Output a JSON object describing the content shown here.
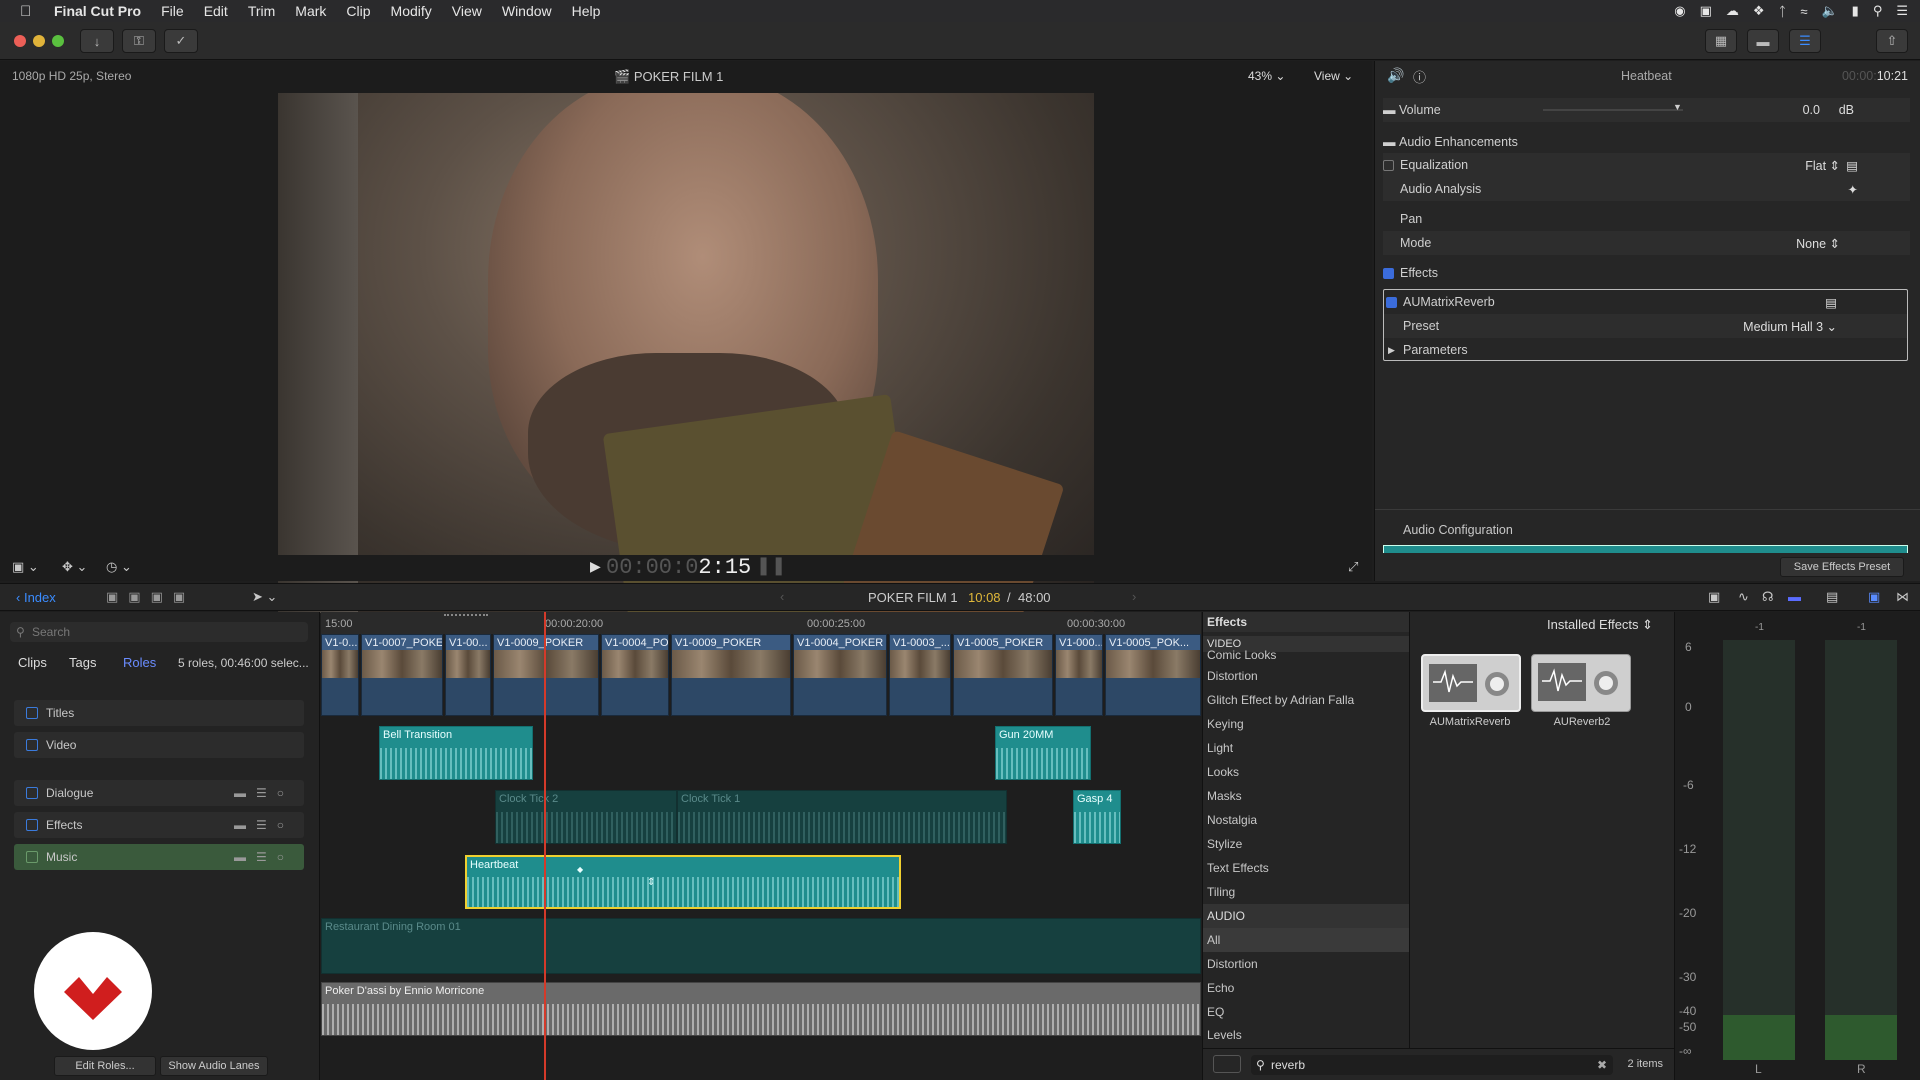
{
  "menubar": {
    "app_name": "Final Cut Pro",
    "items": [
      "File",
      "Edit",
      "Trim",
      "Mark",
      "Clip",
      "Modify",
      "View",
      "Window",
      "Help"
    ]
  },
  "viewer": {
    "format_info": "1080p HD 25p, Stereo",
    "project_title": "POKER FILM 1",
    "zoom": "43%",
    "view_label": "View",
    "timecode_dim": "00:00:0",
    "timecode_bright": "2:15"
  },
  "inspector": {
    "clip_name": "Heatbeat",
    "timecode_dim": "00:00:",
    "timecode_bright": "10:21",
    "volume_label": "Volume",
    "volume_value": "0.0",
    "volume_unit": "dB",
    "audio_enhancements": "Audio Enhancements",
    "equalization": "Equalization",
    "eq_value": "Flat",
    "audio_analysis": "Audio Analysis",
    "pan": "Pan",
    "mode": "Mode",
    "mode_value": "None",
    "effects": "Effects",
    "effect_name": "AUMatrixReverb",
    "preset": "Preset",
    "preset_value": "Medium Hall 3",
    "parameters": "Parameters",
    "audio_configuration": "Audio Configuration",
    "save_preset": "Save Effects Preset"
  },
  "timeline_header": {
    "index": "Index",
    "project": "POKER FILM 1",
    "position": "10:08",
    "duration": "48:00"
  },
  "index_panel": {
    "search_placeholder": "Search",
    "tabs": [
      "Clips",
      "Tags",
      "Roles"
    ],
    "summary": "5 roles, 00:46:00 selec...",
    "roles": [
      "Titles",
      "Video",
      "Dialogue",
      "Effects",
      "Music"
    ],
    "edit_roles": "Edit Roles...",
    "show_audio_lanes": "Show Audio Lanes"
  },
  "ruler": [
    "15:00",
    "00:00:20:00",
    "00:00:25:00",
    "00:00:30:00"
  ],
  "video_clips": [
    "V1-0...",
    "V1-0007_POKER",
    "V1-00...",
    "V1-0009_POKER",
    "V1-0004_PO...",
    "V1-0009_POKER",
    "V1-0004_POKER",
    "V1-0003_...",
    "V1-0005_POKER",
    "V1-000...",
    "V1-0005_POK..."
  ],
  "audio_clips": {
    "bell": "Bell Transition",
    "gun": "Gun 20MM",
    "clock2": "Clock Tick 2",
    "clock1": "Clock Tick 1",
    "gasp": "Gasp 4",
    "heartbeat": "Heartbeat",
    "restaurant": "Restaurant Dining Room 01",
    "music": "Poker D'assi by Ennio Morricone"
  },
  "effects_browser": {
    "title": "Effects",
    "filter": "Installed Effects",
    "video_header": "VIDEO",
    "video_items": [
      "Comic Looks",
      "Distortion",
      "Glitch Effect by Adrian Falla",
      "Keying",
      "Light",
      "Looks",
      "Masks",
      "Nostalgia",
      "Stylize",
      "Text Effects",
      "Tiling"
    ],
    "audio_header": "AUDIO",
    "audio_items": [
      "All",
      "Distortion",
      "Echo",
      "EQ",
      "Levels"
    ],
    "results": [
      "AUMatrixReverb",
      "AUReverb2"
    ],
    "search_value": "reverb",
    "count": "2 items"
  },
  "meters": {
    "scale": [
      "6",
      "0",
      "-6",
      "-12",
      "-20",
      "-30",
      "-40",
      "-50",
      "-∞"
    ],
    "top_left": "-1",
    "top_right": "-1",
    "left": "L",
    "right": "R"
  }
}
